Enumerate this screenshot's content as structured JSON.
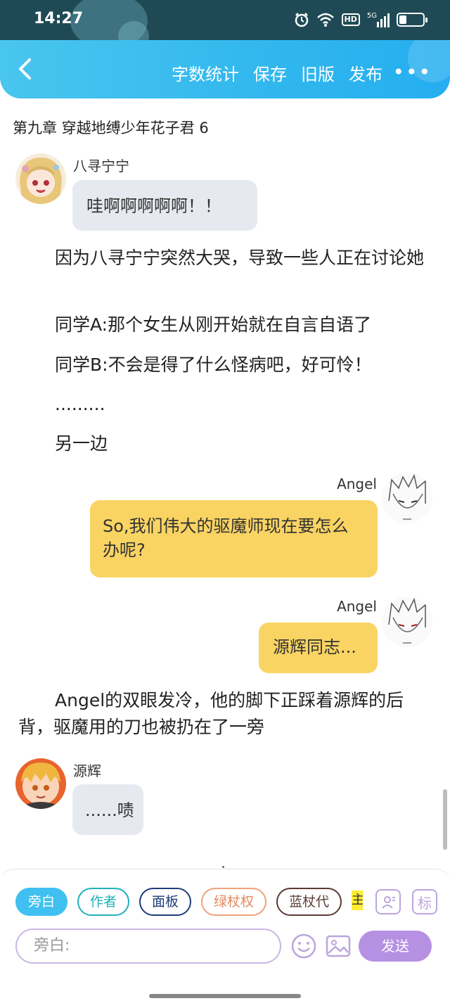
{
  "status_bar": {
    "time": "14:27",
    "hd_label": "HD",
    "signal_label": "5G",
    "battery_level": 0.3
  },
  "toolbar": {
    "items": [
      "字数统计",
      "保存",
      "旧版",
      "发布"
    ],
    "more_label": "•••"
  },
  "chapter": {
    "title": "第九章   穿越地缚少年花子君 6"
  },
  "messages": {
    "m1": {
      "speaker": "八寻宁宁",
      "text": "哇啊啊啊啊啊！！"
    },
    "m2": {
      "speaker": "Angel",
      "text": "So,我们伟大的驱魔师现在要怎么办呢?"
    },
    "m3": {
      "speaker": "Angel",
      "text": "源辉同志..."
    },
    "m4": {
      "speaker": "源辉",
      "text": "......啧"
    }
  },
  "paragraphs": {
    "p1": "因为八寻宁宁突然大哭，导致一些人正在讨论她",
    "p2": "同学A:那个女生从刚开始就在自言自语了",
    "p3": "同学B:不会是得了什么怪病吧，好可怜！",
    "p4": ".........",
    "p5": "另一边",
    "p6": "Angel的双眼发冷，他的脚下正踩着源辉的后背，驱魔用的刀也被扔在了一旁"
  },
  "composer": {
    "roles": [
      "旁白",
      "作者",
      "面板",
      "绿杖权",
      "蓝杖代"
    ],
    "partial_role": "主",
    "square_btn_2": "标",
    "input_placeholder": "旁白:",
    "send_label": "发送"
  },
  "colors": {
    "accent": "#31b7ee",
    "bubble_left": "#e6eaf0",
    "bubble_right": "#fad463",
    "send": "#b690e3"
  }
}
